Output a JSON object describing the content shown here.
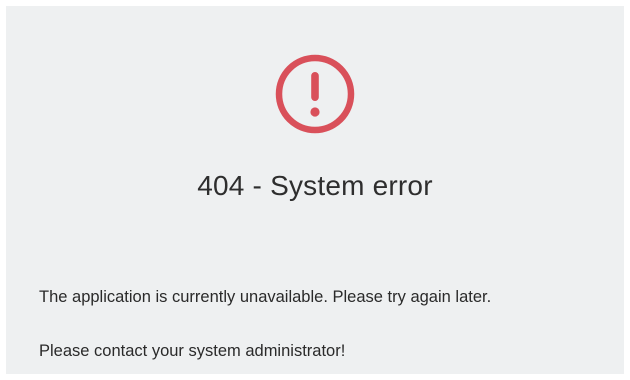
{
  "error": {
    "icon": "exclamation-circle-icon",
    "icon_color": "#d9505a",
    "title": "404 - System error",
    "message_unavailable": "The application is currently unavailable. Please try again later.",
    "message_contact": "Please contact your system administrator!"
  }
}
